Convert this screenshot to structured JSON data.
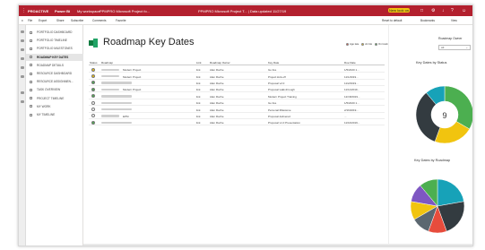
{
  "topbar": {
    "app_name": "PROACTIVE",
    "product": "Power Bi",
    "workspace": "My workspace",
    "report": "PPMPRO Microsoft Project fo...",
    "window_title": "PPMPRO Microsoft Project T... | Data updated 11/27/19",
    "trial": "New look on",
    "accent": "#b3202e"
  },
  "cmdbar": {
    "file": "File",
    "export": "Export",
    "share": "Share",
    "subscribe": "Subscribe",
    "comments": "Comments",
    "favorite": "Favorite",
    "reset": "Reset to default",
    "bookmarks": "Bookmarks",
    "view": "View"
  },
  "nav": {
    "items": [
      {
        "label": "PORTFOLIO DASHBOARD",
        "active": false
      },
      {
        "label": "PORTFOLIO TIMELINE",
        "active": false
      },
      {
        "label": "PORTFOLIO MILESTONES",
        "active": false
      },
      {
        "label": "ROADMAP KEY DATES",
        "active": true
      },
      {
        "label": "ROADMAP DETAILS",
        "active": false
      },
      {
        "label": "RESOURCE DASHBOARD",
        "active": false
      },
      {
        "label": "RESOURCE ASSIGNMEN...",
        "active": false
      },
      {
        "label": "TASK OVERVIEW",
        "active": false
      },
      {
        "label": "PROJECT TIMELINE",
        "active": false
      },
      {
        "label": "MY WORK",
        "active": false
      },
      {
        "label": "MY TIMELINE",
        "active": false
      }
    ]
  },
  "page": {
    "title": "Roadmap Key Dates"
  },
  "legend": {
    "items": [
      {
        "label": "Ago late",
        "color": "#e74c3c"
      },
      {
        "label": "At risk",
        "color": "#f1c40f"
      },
      {
        "label": "On track",
        "color": "#4caf50"
      },
      {
        "label": "Not set",
        "color": "#ffffff"
      },
      {
        "label": "Done",
        "color": "#2e7d32"
      }
    ]
  },
  "grid": {
    "headers": [
      "Status",
      "Roadmap",
      "Link",
      "Roadmap Owner",
      "Key Date",
      "Due Date"
    ],
    "rows": [
      {
        "status": "#f1c40f",
        "roadmap": "Modern Project",
        "link": "link",
        "owner": "Alan Roche",
        "key": "Go live",
        "due": "1/5/2020 1..."
      },
      {
        "status": "#f1c40f",
        "roadmap": "Modern Project",
        "link": "link",
        "owner": "Alan Roche",
        "key": "Project kick-off",
        "due": "11/1/2019..."
      },
      {
        "status": "#4caf50",
        "roadmap": "",
        "link": "link",
        "owner": "Alan Roche",
        "key": "Proposal v2.0",
        "due": "11/2/2019..."
      },
      {
        "status": "#4caf50",
        "roadmap": "Modern Project",
        "link": "link",
        "owner": "Alan Roche",
        "key": "Proposal walk-through",
        "due": "11/11/2019..."
      },
      {
        "status": "#4caf50",
        "roadmap": "",
        "link": "link",
        "owner": "Alan Roche",
        "key": "Modern Project Training",
        "due": "12/18/2019..."
      },
      {
        "status": "#ffffff",
        "roadmap": "",
        "link": "link",
        "owner": "Alan Roche",
        "key": "Go live",
        "due": "1/5/2020 1..."
      },
      {
        "status": "#ffffff",
        "roadmap": "",
        "link": "link",
        "owner": "Alan Roche",
        "key": "Personal Milestone",
        "due": "2/16/2019..."
      },
      {
        "status": "#ffffff",
        "roadmap": "EPM",
        "link": "link",
        "owner": "Alan Roche",
        "key": "Proposal delivered",
        "due": "..."
      },
      {
        "status": "#4caf50",
        "roadmap": "",
        "link": "link",
        "owner": "Alan Roche",
        "key": "Proposal v1.0 Presentation",
        "due": "11/10/2019..."
      }
    ]
  },
  "right": {
    "owner_label": "Roadmap Owner",
    "owner_value": "All",
    "donut_title": "Key Dates by Status",
    "donut_center": "9",
    "pie_title": "Key Dates by Roadmap"
  },
  "donut": {
    "slices": [
      {
        "value": 3,
        "color": "#4caf50"
      },
      {
        "value": 2,
        "color": "#f1c40f"
      },
      {
        "value": 3,
        "color": "#333b40"
      },
      {
        "value": 1,
        "color": "#17a2b8"
      }
    ]
  },
  "pie": {
    "slices": [
      {
        "value": 2,
        "color": "#17a2b8"
      },
      {
        "value": 2,
        "color": "#333b40"
      },
      {
        "value": 1,
        "color": "#e74c3c"
      },
      {
        "value": 1,
        "color": "#5b6770"
      },
      {
        "value": 1,
        "color": "#f1c40f"
      },
      {
        "value": 1,
        "color": "#7e57c2"
      },
      {
        "value": 1,
        "color": "#4caf50"
      }
    ]
  }
}
